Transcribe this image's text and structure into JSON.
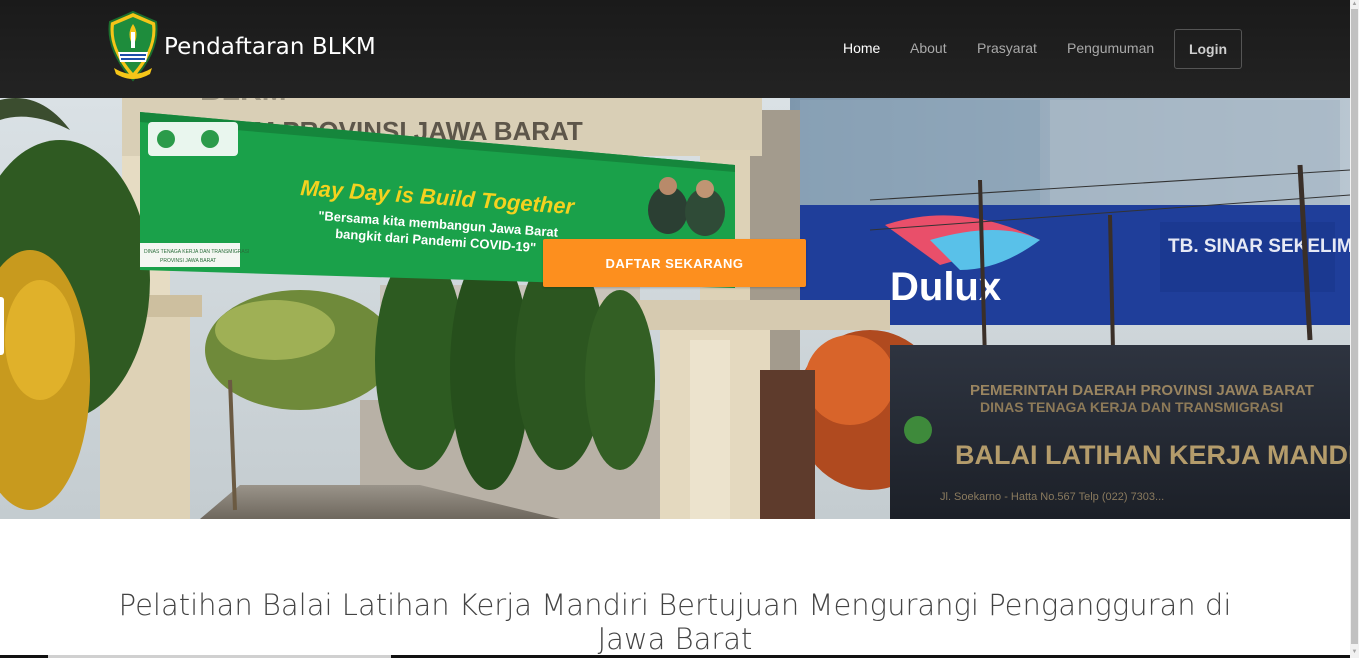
{
  "brand": {
    "name": "Pendaftaran BLKM",
    "logo_icon": "west-java-emblem-icon"
  },
  "nav": {
    "items": [
      {
        "label": "Home",
        "active": true
      },
      {
        "label": "About",
        "active": false
      },
      {
        "label": "Prasyarat",
        "active": false
      },
      {
        "label": "Pengumuman",
        "active": false
      }
    ],
    "login_label": "Login"
  },
  "hero": {
    "cta_label": "DAFTAR SEKARANG",
    "gate_sign": "BLKM PROVINSI JAWA BARAT",
    "banner_title": "May Day is Build Together",
    "banner_sub1": "\"Bersama kita membangun Jawa Barat",
    "banner_sub2": "bangkit dari Pandemi COVID-19\"",
    "banner_foot1": "DINAS TENAGA KERJA DAN TRANSMIGRASI",
    "banner_foot2": "PROVINSI JAWA BARAT",
    "store_sign": "TB. SINAR SEKELIMUS",
    "dulux": "Dulux",
    "board_line1": "PEMERINTAH DAERAH PROVINSI JAWA BARAT",
    "board_line2": "DINAS TENAGA KERJA DAN TRANSMIGRASI",
    "board_line3": "BALAI LATIHAN KERJA MANDIRI",
    "board_line4": "Jl. Soekarno - Hatta No.567 Telp (022) 7303..."
  },
  "content": {
    "headline": "Pelatihan Balai Latihan Kerja Mandiri Bertujuan Mengurangi Pengangguran di Jawa Barat"
  },
  "colors": {
    "cta": "#fd8f1e",
    "navbar": "#1f1f1f",
    "banner_green": "#1aa14a"
  }
}
